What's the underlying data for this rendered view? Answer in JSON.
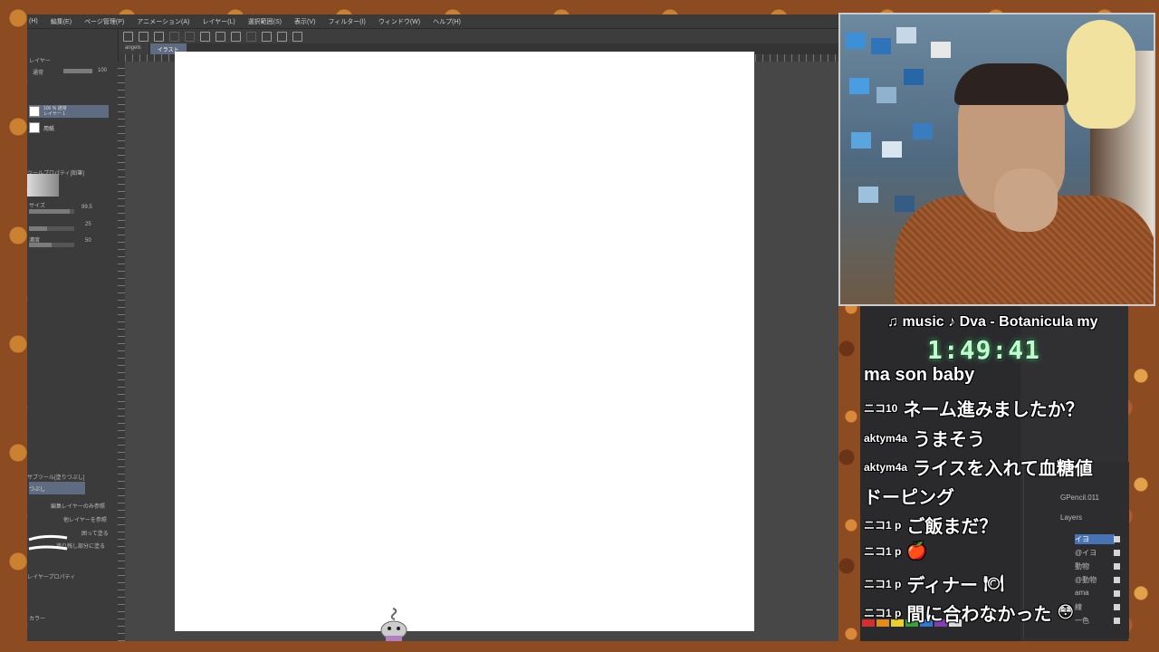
{
  "menubar": {
    "items": [
      "(H)",
      "編集(E)",
      "ページ管理(P)",
      "アニメーション(A)",
      "レイヤー(L)",
      "選択範囲(S)",
      "表示(V)",
      "フィルター(I)",
      "ウィンドウ(W)",
      "ヘルプ(H)"
    ]
  },
  "tabs": [
    "angels",
    "イラスト"
  ],
  "left_panel": {
    "title": "レイヤー",
    "blend_mode": "通常",
    "opacity": "100",
    "layers": [
      {
        "name": "100 % 通常\nレイヤー 1"
      },
      {
        "name": "用紙"
      }
    ],
    "tool_property_title": "ツールプロパティ[鉛筆]",
    "size_label": "サイズ",
    "size_value": "99.5",
    "value2": "25",
    "density_label": "濃度",
    "density_value": "50",
    "subtool_title": "サブツール[塗りつぶし]",
    "subtool_selected": "つぶし",
    "subtool_items": [
      "編集レイヤーのみ参照",
      "他レイヤーを参照",
      "囲って塗る",
      "塗り残し部分に塗る"
    ],
    "layer_property": "レイヤープロパティ",
    "color_label": "カラー"
  },
  "overlay": {
    "music": "♫ music ♪ Dva - Botanicula my",
    "timer": "1:49:41",
    "chat": [
      {
        "user": "",
        "msg": "ma son baby",
        "emoji": ""
      },
      {
        "user": "ニコ10",
        "msg": "ネーム進みましたか？",
        "emoji": ""
      },
      {
        "user": "aktym4a",
        "msg": "うまそう",
        "emoji": ""
      },
      {
        "user": "aktym4a",
        "msg": "ライスを入れて血糖値",
        "emoji": ""
      },
      {
        "user": "",
        "msg": "ドーピング",
        "emoji": ""
      },
      {
        "user": "ニコ1 p",
        "msg": "ご飯まだ？",
        "emoji": ""
      },
      {
        "user": "ニコ1 p",
        "msg": "",
        "emoji": "🍎"
      },
      {
        "user": "ニコ1 p",
        "msg": "ディナー",
        "emoji": "🍽"
      },
      {
        "user": "ニコ1 p",
        "msg": "間に合わなかった",
        "emoji": "😳"
      }
    ],
    "blender": {
      "object": "GPencil.011",
      "panel": "Layers",
      "layers": [
        "イヨ",
        "@イヨ",
        "動物",
        "@動物",
        "ama",
        "線",
        "一色"
      ]
    }
  },
  "colors": {
    "timer_glow": "#39d36a",
    "layer_active": "#5e6b80",
    "canvas": "#ffffff"
  }
}
